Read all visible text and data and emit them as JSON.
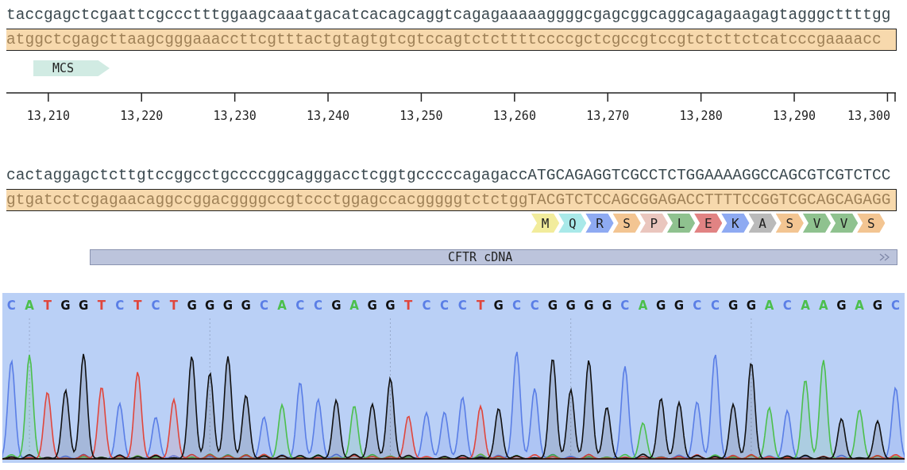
{
  "blocks": [
    {
      "top_strand": "taccgagctcgaattcgccctttggaagcaaatgacatcacagcaggtcagagaaaaaggggcgagcggcaggcagagaagagtagggcttttgg",
      "bottom_strand": "atggctcgagcttaagcgggaaaccttcgtttactgtagtgtcgtccagtctcttttccccgctcgccgtccgtctcttctcatcccgaaaacc",
      "features": [
        {
          "kind": "arrow",
          "label": "MCS"
        }
      ],
      "ruler": [
        "13,210",
        "13,220",
        "13,230",
        "13,240",
        "13,250",
        "13,260",
        "13,270",
        "13,280",
        "13,290",
        "13,300"
      ]
    },
    {
      "top_strand": "cactaggagctcttgtccggcctgccccggcagggacctcggtgcccccagagaccATGCAGAGGTCGCCTCTGGAAAAGGCCAGCGTCGTCTCC",
      "bottom_strand": "gtgatcctcgagaacaggccggacggggccgtccctggagccacgggggtctctggTACGTCTCCAGCGGAGACCTTTTCCGGTCGCAGCAGAGG",
      "translation": [
        {
          "aa": "M",
          "color": "#f2ec9c"
        },
        {
          "aa": "Q",
          "color": "#a9e9e9"
        },
        {
          "aa": "R",
          "color": "#8eaaf2"
        },
        {
          "aa": "S",
          "color": "#f3c592"
        },
        {
          "aa": "P",
          "color": "#eac6be"
        },
        {
          "aa": "L",
          "color": "#8fc28f"
        },
        {
          "aa": "E",
          "color": "#e18383"
        },
        {
          "aa": "K",
          "color": "#8eaaf2"
        },
        {
          "aa": "A",
          "color": "#bababa"
        },
        {
          "aa": "S",
          "color": "#f3c592"
        },
        {
          "aa": "V",
          "color": "#8fc28f"
        },
        {
          "aa": "V",
          "color": "#8fc28f"
        },
        {
          "aa": "S",
          "color": "#f3c592"
        }
      ],
      "features": [
        {
          "kind": "bar",
          "label": "CFTR cDNA"
        }
      ]
    }
  ],
  "chromatogram": {
    "bases": [
      {
        "base": "C",
        "color": "#5a7ee6"
      },
      {
        "base": "A",
        "color": "#4cbf4c"
      },
      {
        "base": "T",
        "color": "#e0463c"
      },
      {
        "base": "G",
        "color": "#111111"
      },
      {
        "base": "G",
        "color": "#111111"
      },
      {
        "base": "T",
        "color": "#e0463c"
      },
      {
        "base": "C",
        "color": "#5a7ee6"
      },
      {
        "base": "T",
        "color": "#e0463c"
      },
      {
        "base": "C",
        "color": "#5a7ee6"
      },
      {
        "base": "T",
        "color": "#e0463c"
      },
      {
        "base": "G",
        "color": "#111111"
      },
      {
        "base": "G",
        "color": "#111111"
      },
      {
        "base": "G",
        "color": "#111111"
      },
      {
        "base": "G",
        "color": "#111111"
      },
      {
        "base": "C",
        "color": "#5a7ee6"
      },
      {
        "base": "A",
        "color": "#4cbf4c"
      },
      {
        "base": "C",
        "color": "#5a7ee6"
      },
      {
        "base": "C",
        "color": "#5a7ee6"
      },
      {
        "base": "G",
        "color": "#111111"
      },
      {
        "base": "A",
        "color": "#4cbf4c"
      },
      {
        "base": "G",
        "color": "#111111"
      },
      {
        "base": "G",
        "color": "#111111"
      },
      {
        "base": "T",
        "color": "#e0463c"
      },
      {
        "base": "C",
        "color": "#5a7ee6"
      },
      {
        "base": "C",
        "color": "#5a7ee6"
      },
      {
        "base": "C",
        "color": "#5a7ee6"
      },
      {
        "base": "T",
        "color": "#e0463c"
      },
      {
        "base": "G",
        "color": "#111111"
      },
      {
        "base": "C",
        "color": "#5a7ee6"
      },
      {
        "base": "C",
        "color": "#5a7ee6"
      },
      {
        "base": "G",
        "color": "#111111"
      },
      {
        "base": "G",
        "color": "#111111"
      },
      {
        "base": "G",
        "color": "#111111"
      },
      {
        "base": "G",
        "color": "#111111"
      },
      {
        "base": "C",
        "color": "#5a7ee6"
      },
      {
        "base": "A",
        "color": "#4cbf4c"
      },
      {
        "base": "G",
        "color": "#111111"
      },
      {
        "base": "G",
        "color": "#111111"
      },
      {
        "base": "C",
        "color": "#5a7ee6"
      },
      {
        "base": "C",
        "color": "#5a7ee6"
      },
      {
        "base": "G",
        "color": "#111111"
      },
      {
        "base": "G",
        "color": "#111111"
      },
      {
        "base": "A",
        "color": "#4cbf4c"
      },
      {
        "base": "C",
        "color": "#5a7ee6"
      },
      {
        "base": "A",
        "color": "#4cbf4c"
      },
      {
        "base": "A",
        "color": "#4cbf4c"
      },
      {
        "base": "G",
        "color": "#111111"
      },
      {
        "base": "A",
        "color": "#4cbf4c"
      },
      {
        "base": "G",
        "color": "#111111"
      },
      {
        "base": "C",
        "color": "#5a7ee6"
      }
    ]
  }
}
